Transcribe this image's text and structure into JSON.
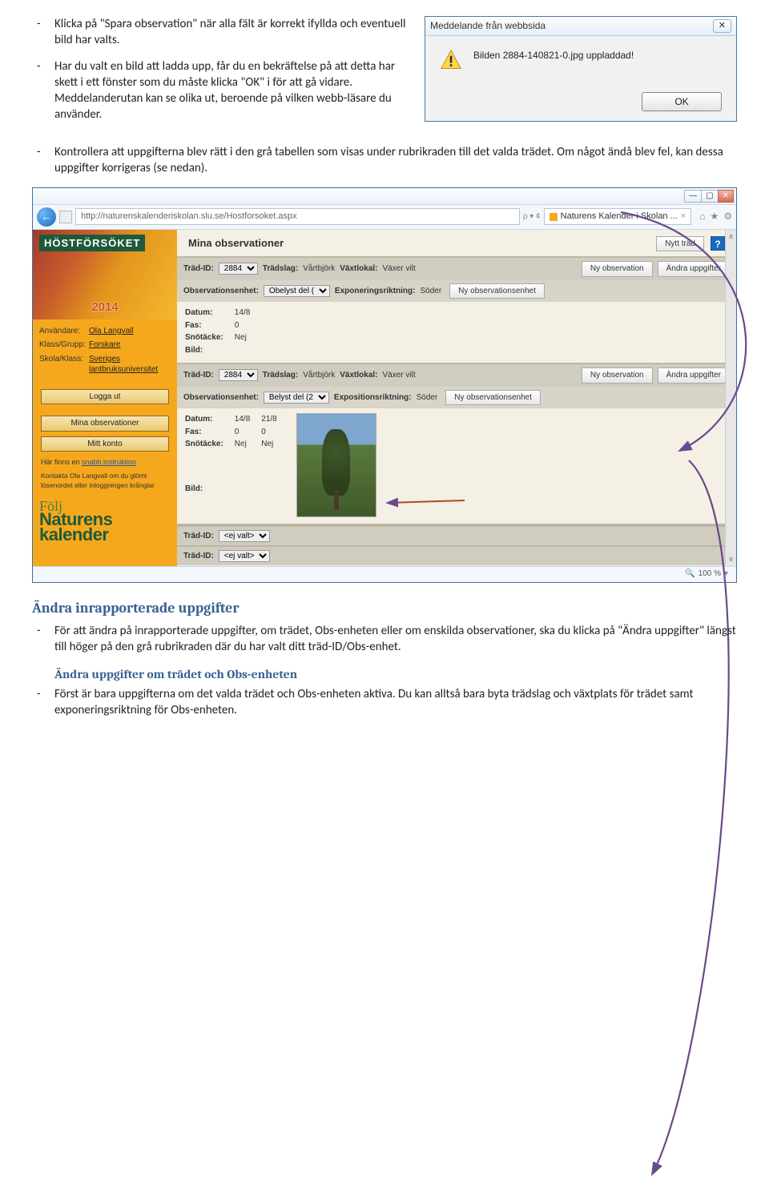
{
  "bullets_top": [
    "Klicka på \"Spara observation\" när alla fält är korrekt ifyllda och eventuell bild har valts.",
    "Har du valt en bild att ladda upp, får du en bekräftelse på att detta har skett i ett fönster som du måste klicka \"OK\" i för att gå vidare. Meddelanderutan kan se olika ut, beroende på vilken webb-läsare du använder.",
    "Kontrollera att uppgifterna blev rätt i den grå tabellen som visas under rubrikraden till det valda trädet. Om något ändå blev fel, kan dessa uppgifter korrigeras (se nedan)."
  ],
  "dialog": {
    "title": "Meddelande från webbsida",
    "message": "Bilden 2884-140821-0.jpg uppladdad!",
    "ok": "OK",
    "close": "✕"
  },
  "browser": {
    "url": "http://naturenskalenderiskolan.slu.se/Hostforsoket.aspx",
    "search_hint": "ρ ▾ ¢",
    "tab_title": "Naturens Kalender i Skolan ...",
    "zoom": "100 %",
    "win_min": "—",
    "win_max": "▢",
    "win_close": "✕"
  },
  "sidebar": {
    "banner_title": "HÖSTFÖRSÖKET",
    "banner_year": "2014",
    "user_label": "Användare:",
    "user_value": "Ola Langvall",
    "group_label": "Klass/Grupp:",
    "group_value": "Forskare",
    "school_label": "Skola/Klass:",
    "school_value": "Sveriges lantbruksuniversitet",
    "btn_logout": "Logga ut",
    "btn_obs": "Mina observationer",
    "btn_account": "Mitt konto",
    "note1_pre": "Här finns en ",
    "note1_link": "snabb instruktion",
    "note2": "Kontakta Ola Langvall om du glömt lösenordet eller inloggningen krånglar",
    "logo_script": "Följ",
    "logo_line1": "Naturens",
    "logo_line2": "kalender"
  },
  "content": {
    "page_title": "Mina observationer",
    "btn_new_tree": "Nytt träd",
    "help": "?",
    "labels": {
      "trad_id": "Träd-ID:",
      "tradslag": "Trädslag:",
      "vaxtlokal": "Växtlokal:",
      "obs_enhet": "Observationsenhet:",
      "exp_rikt": "Exponeringsriktning:",
      "expos_rikt": "Expositionsriktning:",
      "datum": "Datum:",
      "fas": "Fas:",
      "sno": "Snötäcke:",
      "bild": "Bild:",
      "ej_valt": "<ej valt>"
    },
    "blocks": [
      {
        "trad_id": "2884",
        "tradslag": "Vårtbjörk",
        "vaxtlokal": "Växer vilt",
        "obs_enhet": "Obelyst del (",
        "exp_rikt": "Söder",
        "btn_new_unit": "Ny observationsenhet",
        "btn_new_obs": "Ny observation",
        "btn_edit": "Ändra uppgifter",
        "rows": [
          {
            "datum": "14/8",
            "fas": "0",
            "sno": "Nej"
          }
        ]
      },
      {
        "trad_id": "2884",
        "tradslag": "Vårtbjörk",
        "vaxtlokal": "Växer vilt",
        "obs_enhet": "Belyst del (2",
        "exp_rikt": "Söder",
        "btn_new_unit": "Ny observationsenhet",
        "btn_new_obs": "Ny observation",
        "btn_edit": "Ändra uppgifter",
        "rows": [
          {
            "datum": "14/8",
            "fas": "0",
            "sno": "Nej"
          },
          {
            "datum": "21/8",
            "fas": "0",
            "sno": "Nej"
          }
        ]
      }
    ]
  },
  "section2": {
    "heading": "Ändra inrapporterade uppgifter",
    "bullet": "För att ändra på inrapporterade uppgifter, om trädet, Obs-enheten eller om enskilda observationer, ska du klicka på \"Ändra uppgifter\" längst till höger på den grå rubrikraden där du har valt ditt träd-ID/Obs-enhet.",
    "subheading": "Ändra uppgifter om trädet och Obs-enheten",
    "bullet2": "Först är bara uppgifterna om det valda trädet och Obs-enheten aktiva. Du kan alltså bara byta trädslag och växtplats för trädet samt exponeringsriktning för Obs-enheten."
  }
}
